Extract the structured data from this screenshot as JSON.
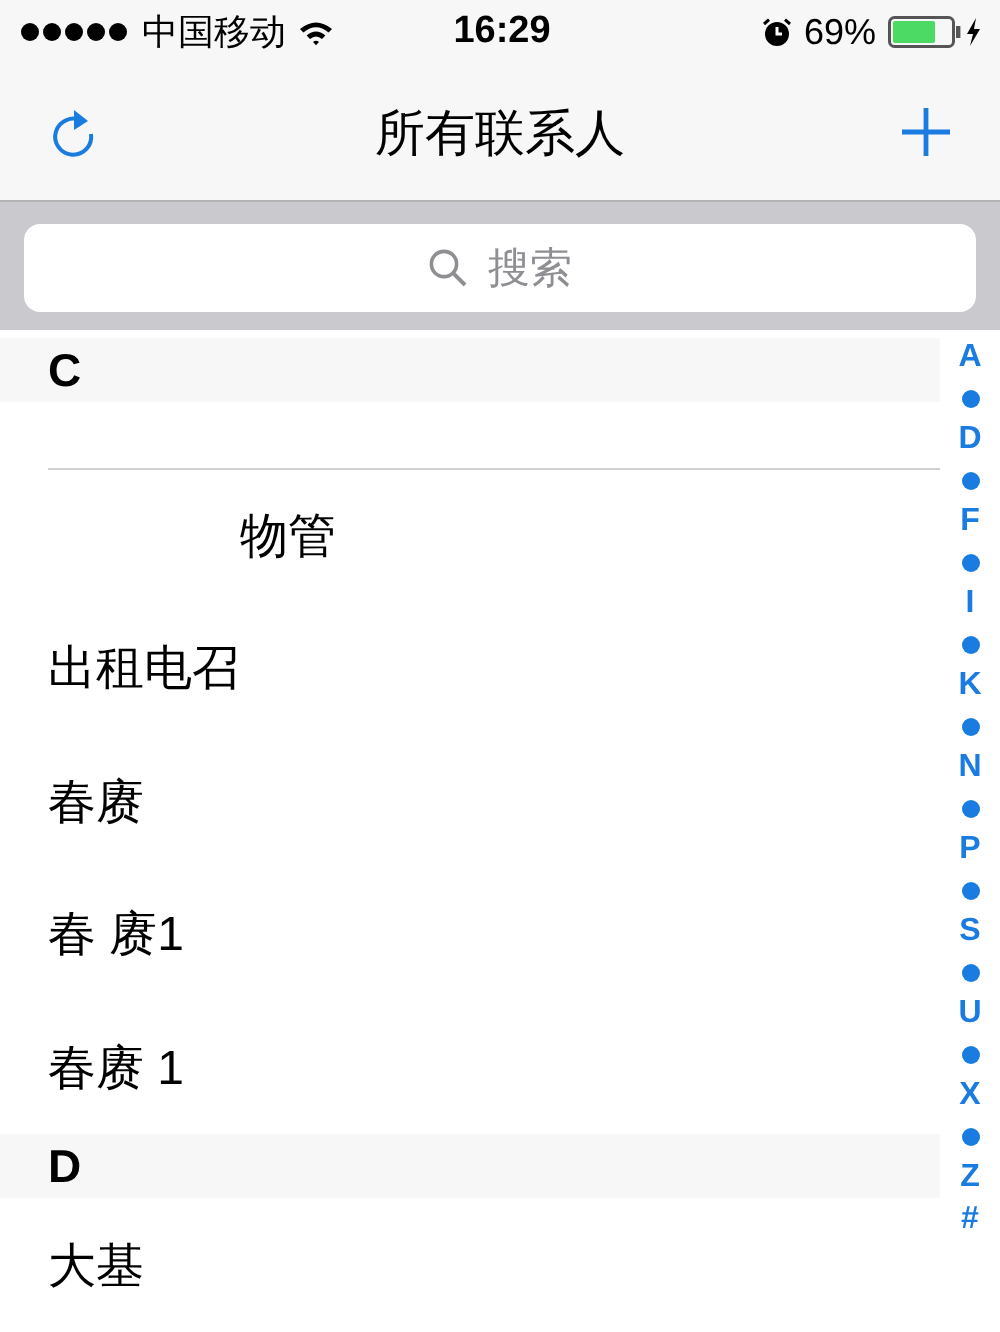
{
  "status_bar": {
    "carrier": "中国移动",
    "time": "16:29",
    "battery": "69%"
  },
  "nav": {
    "title": "所有联系人"
  },
  "search": {
    "placeholder": "搜索"
  },
  "sections": [
    {
      "letter": "C",
      "rows": [
        {
          "covered": true
        },
        {
          "name": "　　　　物管",
          "covered": false
        },
        {
          "name": "出租电召",
          "covered": false
        },
        {
          "name": "春赓",
          "covered": false
        },
        {
          "name": "春 赓1",
          "covered": false
        },
        {
          "name": "春赓 1",
          "covered": false
        }
      ]
    },
    {
      "letter": "D",
      "rows": [
        {
          "name": "大基",
          "covered": false
        }
      ]
    }
  ],
  "index": [
    {
      "kind": "letter",
      "text": "A"
    },
    {
      "kind": "dot"
    },
    {
      "kind": "letter",
      "text": "D"
    },
    {
      "kind": "dot"
    },
    {
      "kind": "letter",
      "text": "F"
    },
    {
      "kind": "dot"
    },
    {
      "kind": "letter",
      "text": "I"
    },
    {
      "kind": "dot"
    },
    {
      "kind": "letter",
      "text": "K"
    },
    {
      "kind": "dot"
    },
    {
      "kind": "letter",
      "text": "N"
    },
    {
      "kind": "dot"
    },
    {
      "kind": "letter",
      "text": "P"
    },
    {
      "kind": "dot"
    },
    {
      "kind": "letter",
      "text": "S"
    },
    {
      "kind": "dot"
    },
    {
      "kind": "letter",
      "text": "U"
    },
    {
      "kind": "dot"
    },
    {
      "kind": "letter",
      "text": "X"
    },
    {
      "kind": "dot"
    },
    {
      "kind": "letter",
      "text": "Z"
    },
    {
      "kind": "letter",
      "text": "#"
    }
  ]
}
